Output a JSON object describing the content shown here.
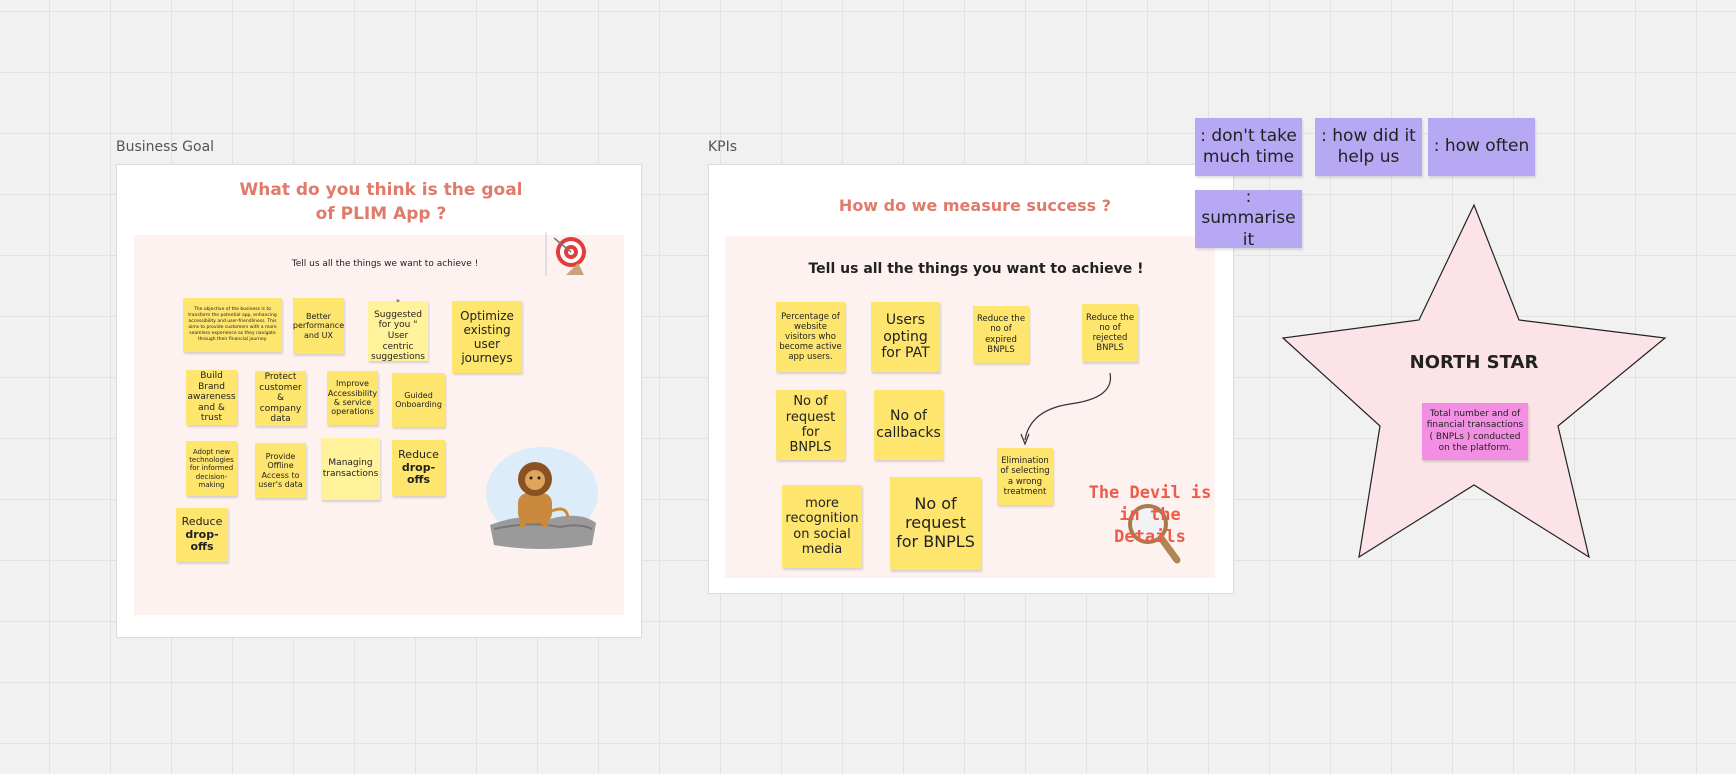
{
  "business_goal": {
    "frame_label": "Business Goal",
    "heading_line1": "What do you think is the goal",
    "heading_line2": "of PLIM App ?",
    "prompt": "Tell us all the things we want to achieve !",
    "stickies": [
      "The objective of the business is to transform the potential app, enhancing accessibility and user-friendliness. This aims to provide customers with a more seamless experience as they navigate through their financial journey.",
      "Better performance and UX",
      "\" Suggested for you \" User centric suggestions",
      "Optimize existing user journeys",
      "Build Brand awareness and & trust",
      "Protect customer & company data",
      "Improve Accessibility & service operations",
      "Guided Onboarding",
      "Adopt new technologies for informed decision-making",
      "Provide Offline Access to user's data",
      "Managing transactions",
      "Reduce",
      "drop-offs",
      "Reduce",
      "drop-offs"
    ]
  },
  "kpis": {
    "frame_label": "KPIs",
    "heading": "How do we measure success ?",
    "prompt": "Tell us all the things you want to achieve !",
    "stickies": [
      "Percentage of website visitors who become active app users.",
      "Users opting for PAT",
      "Reduce the no of expired BNPLS",
      "Reduce the no of rejected BNPLS",
      "No of request for BNPLS",
      "No of callbacks",
      "Elimination of selecting a wrong treatment",
      "more recognition on social media",
      "No of request for BNPLS"
    ],
    "devil_line1": "The Devil is",
    "devil_line2": "in the Details"
  },
  "purple_notes": [
    ": don't take much time",
    ": how did it help us",
    ": how often",
    ": summarise it"
  ],
  "north_star": {
    "title": "NORTH STAR",
    "note": "Total number and of financial transactions ( BNPLs ) conducted on the platform."
  },
  "colors": {
    "canvas": "#f1f1f1",
    "sticky_yellow": "#fde56e",
    "heading_coral": "#e07a6b",
    "purple_note": "#b7a8f4",
    "pink_note": "#f38fe3",
    "star_fill": "#fbe3e7",
    "devil_text": "#ef5b4a"
  }
}
